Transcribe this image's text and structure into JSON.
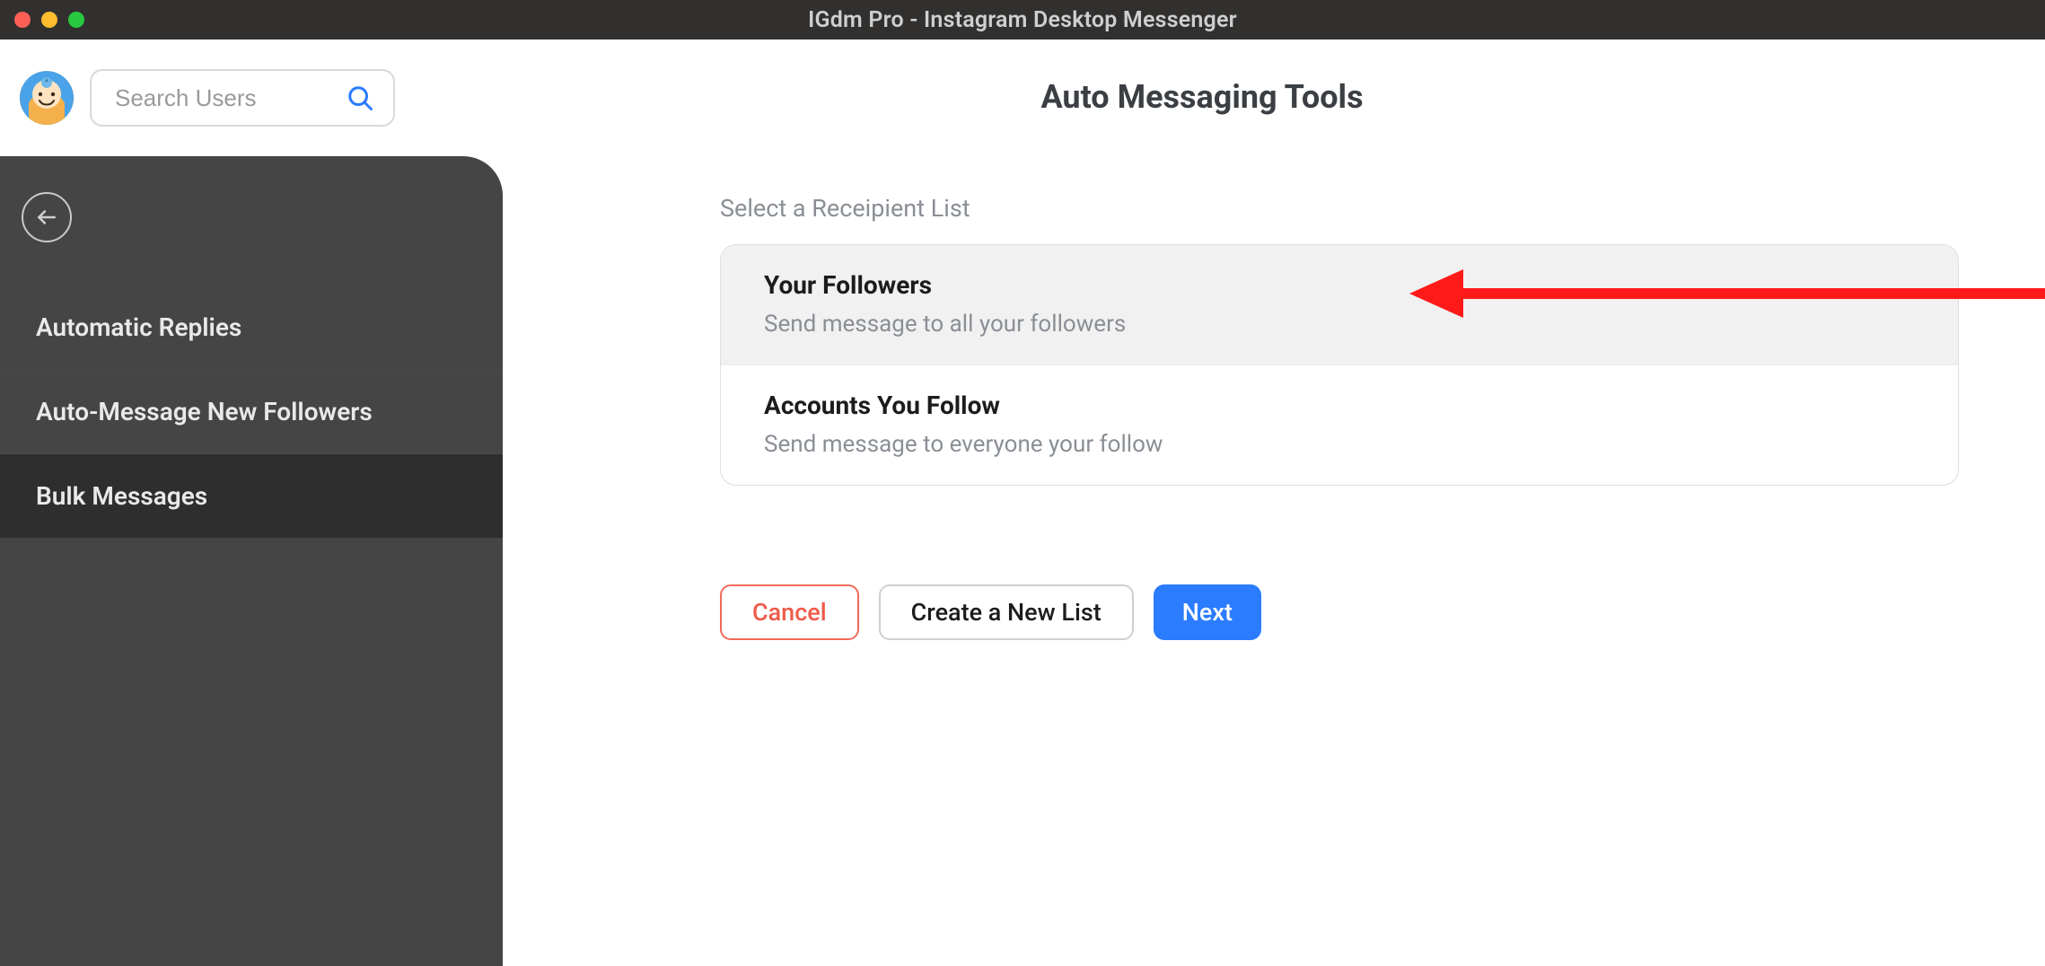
{
  "window": {
    "title": "IGdm Pro - Instagram Desktop Messenger"
  },
  "search": {
    "placeholder": "Search Users"
  },
  "header": {
    "page_title": "Auto Messaging Tools"
  },
  "sidebar": {
    "items": [
      {
        "label": "Automatic Replies"
      },
      {
        "label": "Auto-Message New Followers"
      },
      {
        "label": "Bulk Messages"
      }
    ]
  },
  "main": {
    "section_label": "Select a Receipient List",
    "options": [
      {
        "title": "Your Followers",
        "desc": "Send message to all your followers"
      },
      {
        "title": "Accounts You Follow",
        "desc": "Send message to everyone your follow"
      }
    ],
    "buttons": {
      "cancel": "Cancel",
      "create": "Create a New List",
      "next": "Next"
    }
  },
  "colors": {
    "accent_primary": "#2b7cff",
    "accent_danger": "#ef5a4a",
    "sidebar_bg": "#454545",
    "sidebar_active": "#2e2e2e"
  }
}
